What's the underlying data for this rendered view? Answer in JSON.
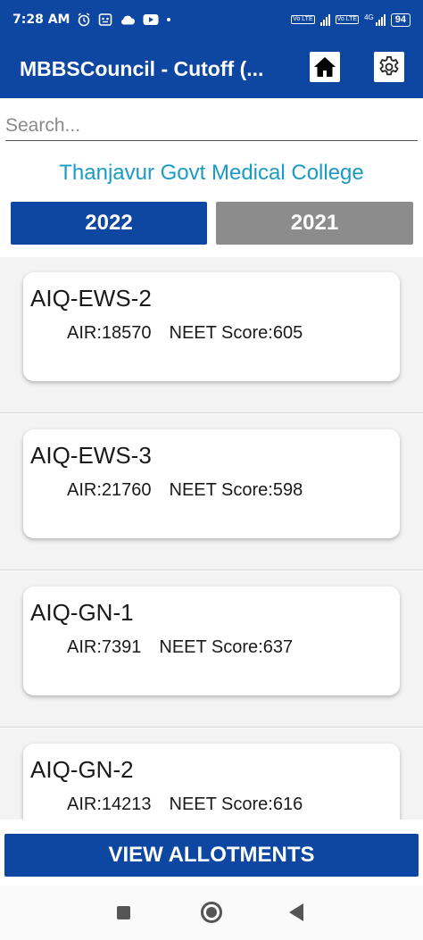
{
  "status": {
    "time": "7:28 AM",
    "battery": "94",
    "network": "4G",
    "volte": "Vo LTE"
  },
  "appbar": {
    "title": "MBBSCouncil - Cutoff (...",
    "home_icon": "home-icon",
    "settings_icon": "gear-icon"
  },
  "search": {
    "placeholder": "Search...",
    "value": ""
  },
  "college": "Thanjavur Govt Medical College",
  "years": [
    "2022",
    "2021"
  ],
  "selected_year": "2022",
  "colors": {
    "primary": "#0d47a1",
    "inactive": "#8c8c8c",
    "college_text": "#1a9bc4"
  },
  "cards": [
    {
      "category": "AIQ-EWS-2",
      "air": "AIR:18570",
      "neet": "NEET Score:605"
    },
    {
      "category": "AIQ-EWS-3",
      "air": "AIR:21760",
      "neet": "NEET Score:598"
    },
    {
      "category": "AIQ-GN-1",
      "air": "AIR:7391",
      "neet": "NEET Score:637"
    },
    {
      "category": "AIQ-GN-2",
      "air": "AIR:14213",
      "neet": "NEET Score:616"
    }
  ],
  "view_button": "VIEW ALLOTMENTS"
}
